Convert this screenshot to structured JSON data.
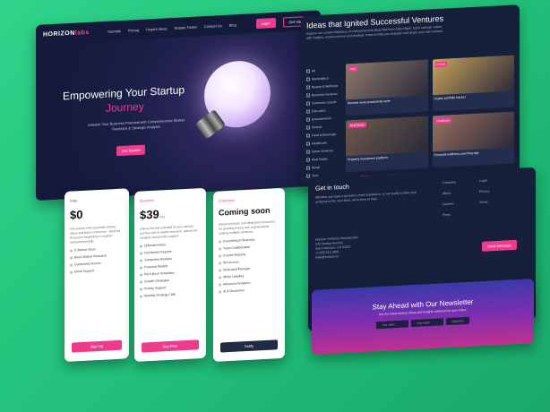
{
  "hero": {
    "logo_main": "HORIZON",
    "logo_accent": "labs",
    "nav": [
      "Tutorials",
      "Pricing",
      "Project Ideas",
      "Rebate Finder",
      "Contact Us",
      "Blog"
    ],
    "login": "Login",
    "signup": "Get Started",
    "title_line1": "Empowering Your Startup",
    "title_line2": "Journey",
    "subtitle": "Unleash Your Business Potential with Comprehensive Market Research & Strategic Analysis",
    "cta": "Get Started"
  },
  "ventures": {
    "title": "Ideas that Ignited Successful Ventures",
    "desc": "Explore our curated database of entrepreneurial ideas that have taken flight. Each concept comes with insights, market context and strategic notes to help you evaluate and shape your own venture.",
    "filters": [
      "All",
      "Marketplace",
      "Beauty & Wellness",
      "Business Services",
      "Consumer Goods",
      "Education",
      "Entertainment",
      "Fintech",
      "Food & Beverage",
      "Healthcare",
      "Home Services",
      "Real Estate",
      "Retail",
      "Tech"
    ],
    "cards": [
      {
        "tag": "Tech",
        "caption": "Remote work productivity suite",
        "color": "#8c7a6b"
      },
      {
        "tag": "Fintech",
        "caption": "Crypto portfolio tracker",
        "color": "#c9a35a"
      },
      {
        "tag": "Real Estate",
        "caption": "Property investment platform",
        "color": "#6e5a4a"
      },
      {
        "tag": "Healthcare",
        "caption": "Personal wellness coaching app",
        "color": "#9a7060"
      }
    ]
  },
  "pricing": [
    {
      "name": "Free",
      "price": "$0",
      "period": "",
      "desc": "Get started with essential startup ideas and basic resources - ideal for those just beginning to explore entrepreneurship.",
      "features": [
        "5 Startup Ideas",
        "Basic Market Research",
        "Community Access",
        "Email Support"
      ],
      "button": "Sign Up",
      "dark": false
    },
    {
      "name": "Business",
      "price": "$39",
      "period": "/mo",
      "desc": "Unlock the full potential of your startup journey with in-depth research, advanced analysis and priority support.",
      "features": [
        "Unlimited Ideas",
        "Full Market Reports",
        "Competitor Analysis",
        "Financial Models",
        "Pitch Deck Templates",
        "Growth Strategies",
        "Priority Support",
        "Monthly Strategy Calls"
      ],
      "button": "Buy Plan",
      "dark": false
    },
    {
      "name": "Enterprise",
      "price": "Coming soon",
      "period": "",
      "desc": "Advanced tools and dedicated resources for growing teams and organizations scaling multiple ventures.",
      "features": [
        "Everything in Business",
        "Team Collaboration",
        "Custom Reports",
        "API Access",
        "Dedicated Manager",
        "White Labeling",
        "Advanced Analytics",
        "SLA Guarantee"
      ],
      "button": "Notify",
      "dark": true
    }
  ],
  "contact": {
    "title": "Get in touch",
    "text": "Whether you have a question, need assistance, or are ready to take your ventures to the next level, we're here to help.",
    "col1": [
      "Company",
      "About",
      "Careers",
      "Press"
    ],
    "col2": [
      "Legal",
      "Privacy",
      "Terms"
    ],
    "info": [
      "Horizon Ventures Incorporated",
      "123 Startup Avenue",
      "San Francisco, CA 94107",
      "+1 555 012 3456",
      "hello@horizon.io"
    ],
    "send": "Send Message"
  },
  "newsletter": {
    "title": "Stay Ahead with Our Newsletter",
    "sub": "Get the latest startup ideas and insights delivered to your inbox.",
    "name_ph": "Your name",
    "email_ph": "Your email",
    "button": "Subscribe"
  }
}
